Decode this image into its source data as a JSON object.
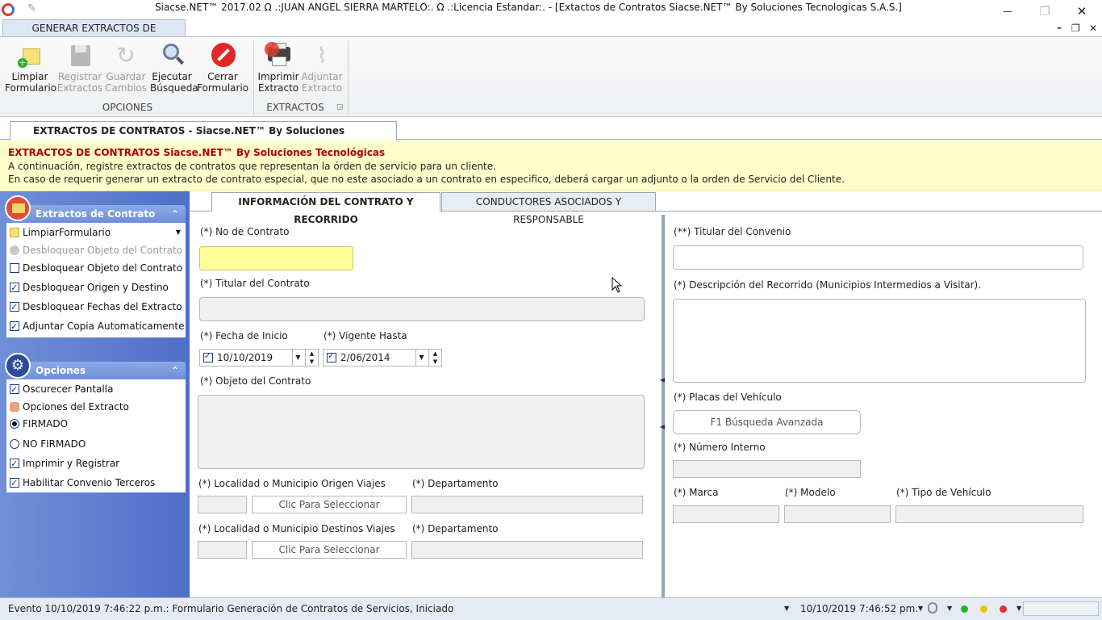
{
  "window": {
    "title": "Siacse.NET™ 2017.02 Ω .:JUAN ANGEL SIERRA MARTELO:. Ω .:Licencia Estandar:. - [Extactos de Contratos Siacse.NET™ By Soluciones Tecnologicas S.A.S.]",
    "minimize": "—",
    "maximize": "❐",
    "close": "✕",
    "inner_min": "–",
    "inner_restore": "❐",
    "inner_close": "✕"
  },
  "ribbon": {
    "tab_label": "GENERAR EXTRACTOS DE CONTRATOS",
    "groups": {
      "opciones": "OPCIONES",
      "extractos": "EXTRACTOS"
    },
    "buttons": {
      "limpiar_1": "Limpiar",
      "limpiar_2": "Formulario",
      "registrar_1": "Registrar",
      "registrar_2": "Extractos",
      "guardar_1": "Guardar",
      "guardar_2": "Cambios",
      "ejecutar_1": "Ejecutar",
      "ejecutar_2": "Búsqueda",
      "cerrar_1": "Cerrar",
      "cerrar_2": "Formulario",
      "imprimir_1": "Imprimir",
      "imprimir_2": "Extracto",
      "adjuntar_1": "Adjuntar",
      "adjuntar_2": "Extracto"
    }
  },
  "doc_tab": "EXTRACTOS DE CONTRATOS - Siacse.NET™ By Soluciones Tecnológicas S.A.S.",
  "band": {
    "heading": "EXTRACTOS DE CONTRATOS Siacse.NET™ By Soluciones Tecnológicas",
    "line1": "A continuación, registre extractos de contratos que representan la órden de servicio para un cliente.",
    "line2": "En caso de requerir generar un extracto de contrato especial, que no este asociado a un contrato en especifico, deberá cargar un adjunto o la orden de Servicio del Cliente."
  },
  "nav": {
    "section1": {
      "title": "Extractos de Contrato",
      "items": {
        "limpiar": "LimpiarFormulario",
        "desbloquear_dis": "Desbloquear Objeto del Contrato",
        "desbloquear_obj": "Desbloquear Objeto del Contrato",
        "desbloquear_org": "Desbloquear Origen y Destino",
        "desbloquear_fec": "Desbloquear Fechas del Extracto",
        "adjuntar": "Adjuntar Copia Automaticamente"
      }
    },
    "section2": {
      "title": "Opciones",
      "items": {
        "oscurecer": "Oscurecer Pantalla",
        "opciones_ext": "Opciones del Extracto",
        "firmado": "FIRMADO",
        "no_firmado": "NO FIRMADO",
        "imprimir": "Imprimir y Registrar",
        "habilitar": "Habilitar Convenio Terceros"
      }
    }
  },
  "tabs": {
    "info": "INFORMACIÓN DEL CONTRATO Y RECORRIDO",
    "conductores": "CONDUCTORES ASOCIADOS Y RESPONSABLE"
  },
  "form_left": {
    "no_contrato": "(*)  No de Contrato",
    "titular_contrato": "(*)  Titular del Contrato",
    "fecha_inicio": "(*)  Fecha de Inicio",
    "fecha_inicio_val": "10/10/2019",
    "vigente_hasta": "(*)  Vigente Hasta",
    "vigente_hasta_val": "2/06/2014",
    "objeto": "(*)  Objeto del Contrato",
    "origen": "(*)  Localidad o Municipio Origen Viajes",
    "destinos": "(*)  Localidad o Municipio Destinos Viajes",
    "departamento": "(*)  Departamento",
    "clic_seleccionar": "Clic Para Seleccionar"
  },
  "form_right": {
    "titular_convenio": "(**) Titular del Convenio",
    "descripcion": "(*)  Descripción del Recorrido (Municipios Intermedios  a Visitar).",
    "placas": "(*)  Placas del Vehículo",
    "busqueda": "F1 Búsqueda Avanzada",
    "numero_interno": "(*)  Número Interno",
    "marca": "(*)  Marca",
    "modelo": "(*)  Modelo",
    "tipo_vehiculo": "(*)  Tipo de Vehículo"
  },
  "status": {
    "evento": "Evento 10/10/2019 7:46:22 p.m.: Formulario Generación de Contratos de Servicios, Iniciado",
    "hora": "10/10/2019 7:46:52 pm.",
    "colors": [
      "#1fb81f",
      "#e5c600",
      "#e03030"
    ]
  }
}
